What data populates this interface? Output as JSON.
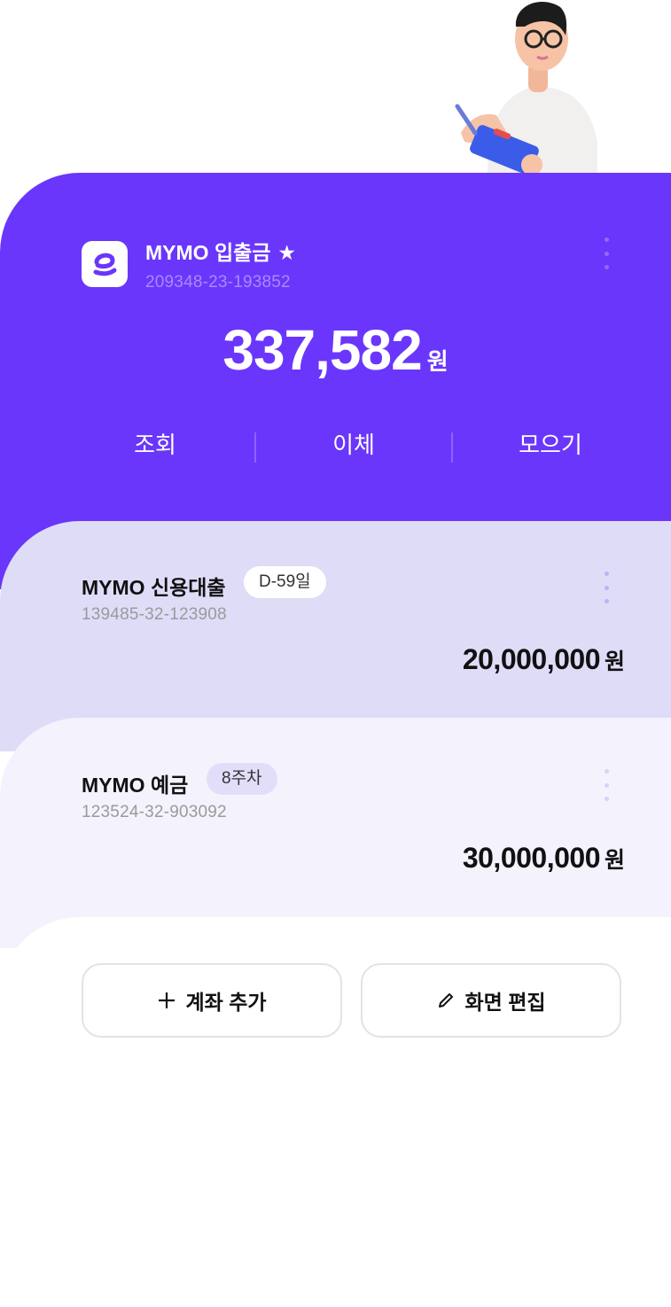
{
  "main_account": {
    "title": "MYMO 입출금",
    "favorite_icon": "star-icon",
    "star": "★",
    "account_number": "209348-23-193852",
    "balance": "337,582",
    "currency": "원",
    "actions": [
      "조회",
      "이체",
      "모으기"
    ]
  },
  "loan_account": {
    "title": "MYMO 신용대출",
    "badge": "D-59일",
    "account_number": "139485-32-123908",
    "amount": "20,000,000",
    "currency": "원"
  },
  "deposit_account": {
    "title": "MYMO 예금",
    "badge": "8주차",
    "account_number": "123524-32-903092",
    "amount": "30,000,000",
    "currency": "원"
  },
  "buttons": {
    "add_account": "계좌 추가",
    "edit_screen": "화면 편집"
  },
  "colors": {
    "brand_purple": "#6a36fb",
    "loan_card_bg": "#dfdcf8",
    "deposit_card_bg": "#f4f2fd"
  },
  "icons": [
    "character-illustration",
    "app-logo-icon",
    "more-vert-icon",
    "plus-icon",
    "pencil-icon"
  ]
}
